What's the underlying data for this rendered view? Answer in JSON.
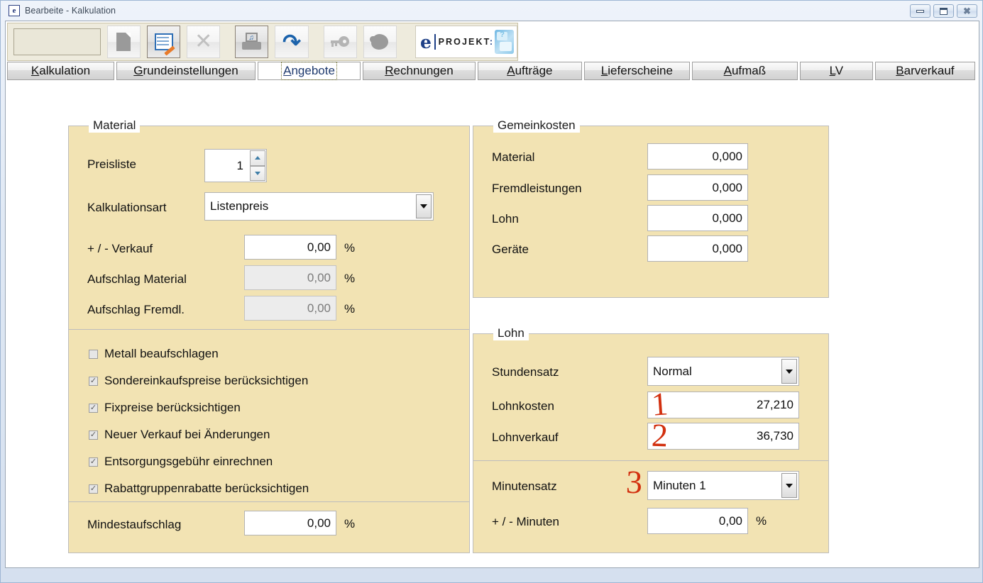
{
  "window": {
    "title": "Bearbeite - Kalkulation",
    "icon": "eprojekt-app-icon",
    "minimize_label": "Minimieren",
    "maximize_label": "Maximieren",
    "close_label": "Schließen"
  },
  "toolbar": {
    "search_field_value": "",
    "buttons": [
      {
        "name": "new-document-button",
        "icon": "document-icon",
        "label": "Neu",
        "state": "normal"
      },
      {
        "name": "edit-document-button",
        "icon": "edit-document-icon",
        "label": "Bearbeiten",
        "state": "pressed"
      },
      {
        "name": "delete-button",
        "icon": "close-x-icon",
        "label": "Löschen",
        "state": "disabled"
      },
      {
        "name": "print-button",
        "icon": "printer-icon",
        "label": "Drucken",
        "state": "pressed"
      },
      {
        "name": "undo-button",
        "icon": "undo-arrow-icon",
        "label": "Rückgängig",
        "state": "normal"
      },
      {
        "name": "key-button",
        "icon": "key-icon",
        "label": "Schlüssel",
        "state": "normal"
      },
      {
        "name": "blob-button",
        "icon": "blob-icon",
        "label": "Extra",
        "state": "normal"
      }
    ],
    "logo": {
      "e": "e",
      "text": "PROJEKT",
      "colon": ":",
      "badge_icon": "speech-bubbles-icon"
    }
  },
  "tabs": [
    {
      "label": "Kalkulation",
      "accel": "K",
      "rest": "alkulation",
      "active": false
    },
    {
      "label": "Grundeinstellungen",
      "accel": "G",
      "rest": "rundeinstellungen",
      "active": false
    },
    {
      "label": "Angebote",
      "accel": "A",
      "rest": "ngebote",
      "active": true
    },
    {
      "label": "Rechnungen",
      "accel": "R",
      "rest": "echnungen",
      "active": false
    },
    {
      "label": "Aufträge",
      "accel": "A",
      "rest": "ufträge",
      "active": false
    },
    {
      "label": "Lieferscheine",
      "accel": "L",
      "rest": "ieferscheine",
      "active": false
    },
    {
      "label": "Aufmaß",
      "accel": "A",
      "rest": "ufmaß",
      "active": false
    },
    {
      "label": "LV",
      "accel": "L",
      "rest": "V",
      "active": false
    },
    {
      "label": "Barverkauf",
      "accel": "B",
      "rest": "arverkauf",
      "active": false
    }
  ],
  "material": {
    "legend": "Material",
    "preisliste_label": "Preisliste",
    "preisliste_value": "1",
    "kalkulationsart_label": "Kalkulationsart",
    "kalkulationsart_value": "Listenpreis",
    "rows": [
      {
        "label": "+ / -   Verkauf",
        "value": "0,00",
        "unit": "%",
        "readonly": false
      },
      {
        "label": "Aufschlag Material",
        "value": "0,00",
        "unit": "%",
        "readonly": true
      },
      {
        "label": "Aufschlag Fremdl.",
        "value": "0,00",
        "unit": "%",
        "readonly": true
      }
    ],
    "checkboxes": [
      {
        "label": "Metall beaufschlagen",
        "checked": false
      },
      {
        "label": "Sondereinkaufspreise berücksichtigen",
        "checked": true
      },
      {
        "label": "Fixpreise berücksichtigen",
        "checked": true
      },
      {
        "label": "Neuer Verkauf bei Änderungen",
        "checked": true
      },
      {
        "label": "Entsorgungsgebühr einrechnen",
        "checked": true
      },
      {
        "label": "Rabattgruppenrabatte berücksichtigen",
        "checked": true
      }
    ],
    "mindestaufschlag_label": "Mindestaufschlag",
    "mindestaufschlag_value": "0,00",
    "mindestaufschlag_unit": "%"
  },
  "gemeinkosten": {
    "legend": "Gemeinkosten",
    "rows": [
      {
        "label": "Material",
        "value": "0,000"
      },
      {
        "label": "Fremdleistungen",
        "value": "0,000"
      },
      {
        "label": "Lohn",
        "value": "0,000"
      },
      {
        "label": "Geräte",
        "value": "0,000"
      }
    ]
  },
  "lohn": {
    "legend": "Lohn",
    "stundensatz_label": "Stundensatz",
    "stundensatz_value": "Normal",
    "lohnkosten_label": "Lohnkosten",
    "lohnkosten_value": "27,210",
    "lohnverkauf_label": "Lohnverkauf",
    "lohnverkauf_value": "36,730",
    "minutensatz_label": "Minutensatz",
    "minutensatz_value": "Minuten 1",
    "plusminus_minuten_label": "+ / - Minuten",
    "plusminus_minuten_value": "0,00",
    "plusminus_minuten_unit": "%"
  },
  "annotations": [
    {
      "text": "1",
      "target": "lohnkosten-field"
    },
    {
      "text": "2",
      "target": "lohnverkauf-field"
    },
    {
      "text": "3",
      "target": "minutensatz-combo"
    }
  ],
  "colors": {
    "panel_bg": "#f2e3b3",
    "toolbar_bg": "#eeebdd",
    "annotation_red": "#d2300f",
    "logo_blue": "#1d3f86",
    "window_frame": "#dce6f1"
  }
}
